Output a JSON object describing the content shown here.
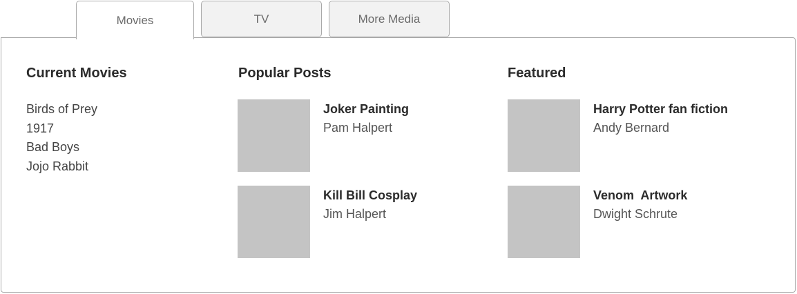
{
  "tabs": [
    {
      "label": "Movies",
      "active": true
    },
    {
      "label": "TV",
      "active": false
    },
    {
      "label": "More Media",
      "active": false
    }
  ],
  "current_movies": {
    "heading": "Current Movies",
    "items": [
      "Birds of Prey",
      "1917",
      "Bad Boys",
      "Jojo Rabbit"
    ]
  },
  "popular_posts": {
    "heading": "Popular Posts",
    "posts": [
      {
        "title": "Joker Painting",
        "author": "Pam Halpert"
      },
      {
        "title": "Kill Bill Cosplay",
        "author": "Jim Halpert"
      }
    ]
  },
  "featured": {
    "heading": "Featured",
    "posts": [
      {
        "title": "Harry Potter fan fiction",
        "author": "Andy Bernard"
      },
      {
        "title": "Venom  Artwork",
        "author": "Dwight Schrute"
      }
    ]
  },
  "colors": {
    "thumbnail_placeholder": "#c4c4c4",
    "border": "#a9a9a9",
    "inactive_tab_bg": "#f2f2f2"
  }
}
